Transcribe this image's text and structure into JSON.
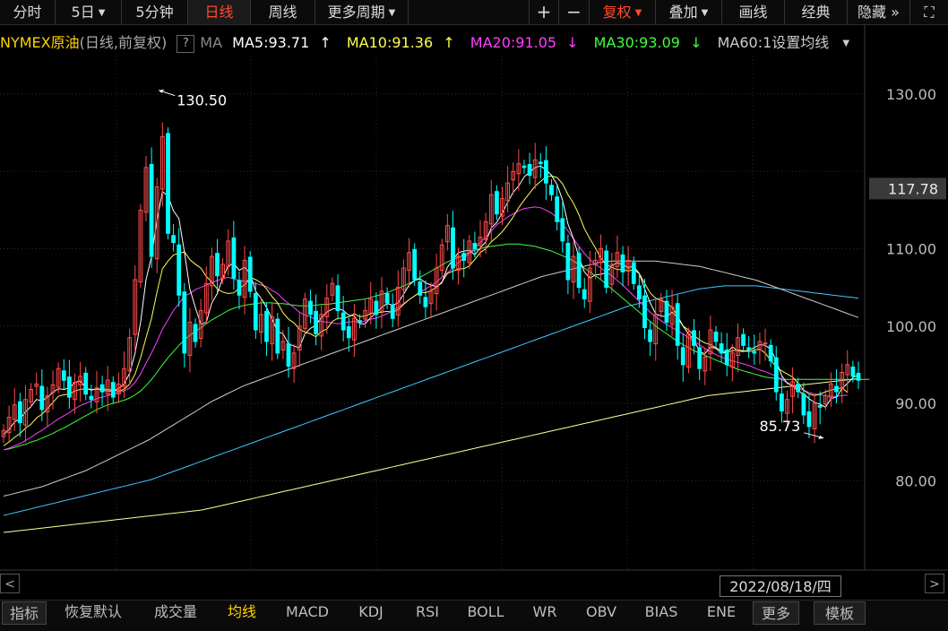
{
  "toolbar": {
    "tabs": [
      {
        "label": "分时"
      },
      {
        "label": "5日"
      },
      {
        "label": "5分钟"
      },
      {
        "label": "日线"
      },
      {
        "label": "周线"
      },
      {
        "label": "更多周期"
      }
    ],
    "plus": "+",
    "minus": "−",
    "fuquan": "复权",
    "diejia": "叠加",
    "huaxian": "画线",
    "jingdian": "经典",
    "yincang": "隐藏",
    "expand_icon": "»",
    "fullscreen_icon": "⛶"
  },
  "legend": {
    "title": "NYMEX原油",
    "subtitle": "(日线,前复权)",
    "help": "?",
    "ma_label": "MA",
    "ma5": "MA5:93.71",
    "ma10": "MA10:91.36",
    "ma20": "MA20:91.05",
    "ma30": "MA30:93.09",
    "ma60": "MA60:1设置均线",
    "up_arrow": "↑",
    "down_arrow": "↓",
    "colors": {
      "ma5": "#ffffff",
      "ma10": "#ffff4d",
      "ma20": "#ff40ff",
      "ma30": "#40ff40",
      "ma60": "#cccccc",
      "ma120": "#3fc8ff",
      "ma250": "#ffff99"
    }
  },
  "yaxis": {
    "ticks": [
      "130.00",
      "110.00",
      "100.00",
      "90.00",
      "80.00"
    ],
    "current_price": "117.78"
  },
  "annotations": {
    "high": "130.50",
    "low": "85.73"
  },
  "date_label": "2022/08/18/四",
  "bottom_tabs": [
    "指标",
    "恢复默认",
    "成交量",
    "均线",
    "MACD",
    "KDJ",
    "RSI",
    "BOLL",
    "WR",
    "OBV",
    "BIAS",
    "ENE",
    "更多",
    "模板"
  ],
  "scroll_left": "<",
  "scroll_right": ">",
  "chart_data": {
    "type": "candlestick",
    "y_range": [
      73,
      134
    ],
    "up_color": "#ff4b4b",
    "down_color": "#00ffff",
    "closes": [
      86.5,
      88.2,
      89.8,
      87.5,
      90.5,
      91.8,
      92.5,
      89.2,
      91.0,
      92.4,
      94.5,
      93.0,
      90.8,
      92.7,
      93.5,
      91.2,
      90.5,
      92.0,
      91.5,
      93.0,
      90.8,
      92.5,
      94.5,
      98.5,
      106.0,
      115.0,
      120.5,
      109.0,
      118.0,
      124.5,
      112.0,
      110.8,
      104.0,
      96.5,
      100.5,
      98.0,
      102.0,
      105.5,
      109.0,
      106.5,
      108.0,
      111.0,
      106.2,
      104.0,
      108.5,
      104.5,
      99.5,
      101.5,
      98.0,
      101.2,
      96.5,
      98.0,
      94.8,
      96.5,
      100.0,
      103.5,
      101.5,
      99.0,
      101.5,
      103.6,
      105.5,
      102.0,
      99.5,
      98.5,
      101.0,
      100.5,
      102.0,
      103.5,
      101.5,
      104.5,
      103.0,
      101.0,
      105.0,
      107.5,
      109.5,
      106.0,
      104.0,
      102.5,
      104.5,
      107.5,
      110.5,
      113.0,
      107.5,
      109.0,
      108.5,
      111.0,
      110.0,
      111.5,
      113.5,
      117.0,
      114.5,
      116.5,
      118.5,
      120.0,
      121.0,
      120.5,
      119.5,
      121.5,
      121.0,
      118.5,
      117.0,
      113.5,
      111.0,
      106.0,
      109.0,
      105.0,
      103.5,
      107.5,
      108.5,
      110.0,
      105.0,
      108.0,
      109.5,
      107.0,
      108.5,
      105.5,
      103.5,
      99.8,
      98.0,
      101.5,
      103.5,
      100.5,
      102.5,
      97.5,
      95.0,
      99.0,
      97.5,
      94.5,
      96.0,
      99.5,
      98.0,
      96.5,
      95.0,
      96.5,
      98.5,
      97.5,
      97.0,
      96.5,
      98.0,
      97.8,
      95.5,
      91.5,
      89.0,
      90.5,
      92.8,
      91.5,
      88.5,
      87.0,
      90.0,
      89.5,
      91.0,
      92.5,
      91.5,
      94.0,
      95.0,
      93.5,
      93.0
    ],
    "ma5": [
      86.0,
      86.6,
      87.6,
      88.0,
      88.9,
      89.6,
      90.5,
      90.3,
      90.8,
      91.4,
      91.9,
      91.8,
      92.0,
      92.7,
      92.9,
      92.0,
      91.7,
      91.9,
      91.7,
      91.6,
      91.6,
      91.9,
      92.5,
      93.9,
      96.5,
      100.5,
      106.0,
      109.0,
      113.7,
      117.4,
      116.8,
      114.9,
      113.9,
      109.6,
      104.8,
      102.4,
      100.2,
      100.5,
      103.0,
      104.2,
      106.2,
      107.8,
      108.1,
      107.2,
      107.6,
      106.8,
      104.5,
      103.6,
      102.4,
      100.9,
      99.3,
      99.0,
      97.7,
      97.4,
      97.2,
      99.0,
      99.7,
      100.1,
      101.1,
      101.8,
      102.2,
      102.3,
      102.0,
      101.4,
      101.3,
      100.3,
      100.3,
      101.1,
      101.7,
      102.4,
      102.9,
      102.7,
      103.0,
      104.1,
      105.3,
      105.9,
      106.1,
      105.6,
      105.3,
      105.1,
      105.6,
      107.6,
      108.6,
      109.5,
      109.7,
      109.8,
      109.2,
      110.1,
      110.9,
      112.7,
      113.4,
      114.6,
      116.0,
      117.3,
      118.1,
      119.3,
      119.9,
      120.5,
      120.7,
      120.2,
      119.5,
      118.3,
      116.3,
      113.2,
      111.3,
      108.9,
      107.0,
      106.2,
      106.6,
      106.7,
      106.9,
      107.8,
      108.2,
      107.9,
      107.6,
      107.7,
      106.8,
      104.8,
      103.0,
      101.6,
      101.3,
      101.2,
      101.8,
      101.1,
      100.0,
      99.0,
      98.2,
      96.7,
      96.4,
      97.3,
      97.1,
      96.5,
      96.6,
      97.3,
      96.8,
      96.7,
      96.9,
      97.2,
      97.6,
      97.5,
      97.0,
      95.5,
      93.6,
      92.6,
      92.3,
      91.6,
      91.2,
      90.6,
      90.1,
      89.9,
      89.5,
      90.6,
      90.8,
      91.9,
      92.6,
      93.3,
      93.7
    ],
    "ma10": [
      84.5,
      85.0,
      85.6,
      86.1,
      86.8,
      87.3,
      88.1,
      88.6,
      89.3,
      90.1,
      90.9,
      91.1,
      91.2,
      91.6,
      91.8,
      91.9,
      91.8,
      91.8,
      91.9,
      91.8,
      91.7,
      91.6,
      91.8,
      92.5,
      93.8,
      95.9,
      98.5,
      101.0,
      104.4,
      107.4,
      108.4,
      109.2,
      109.4,
      109.6,
      108.6,
      108.0,
      107.5,
      106.4,
      105.7,
      104.8,
      104.4,
      104.2,
      104.3,
      104.9,
      105.3,
      106.3,
      106.0,
      105.6,
      104.8,
      103.8,
      103.0,
      101.7,
      100.9,
      100.4,
      99.6,
      99.2,
      99.0,
      98.6,
      99.3,
      99.6,
      100.6,
      101.0,
      101.0,
      101.2,
      101.6,
      101.2,
      101.3,
      101.6,
      101.7,
      101.8,
      101.9,
      101.8,
      102.1,
      102.8,
      103.4,
      103.9,
      104.4,
      104.3,
      104.6,
      105.0,
      105.7,
      106.8,
      107.1,
      107.4,
      107.4,
      107.8,
      108.6,
      109.5,
      110.0,
      110.9,
      111.5,
      112.2,
      113.1,
      114.1,
      115.3,
      116.3,
      117.2,
      118.1,
      118.7,
      119.3,
      119.4,
      119.2,
      118.4,
      117.0,
      115.9,
      114.4,
      112.6,
      111.3,
      110.1,
      108.8,
      107.9,
      107.6,
      107.3,
      107.3,
      107.1,
      107.3,
      106.8,
      105.5,
      104.3,
      103.6,
      103.3,
      103.0,
      102.4,
      101.3,
      100.0,
      99.5,
      98.8,
      98.2,
      97.8,
      97.6,
      97.2,
      96.8,
      96.6,
      96.8,
      96.9,
      96.8,
      96.7,
      96.9,
      97.0,
      96.5,
      95.6,
      94.7,
      94.2,
      93.8,
      93.4,
      92.6,
      91.7,
      91.2,
      91.0,
      91.2,
      91.5,
      91.7,
      91.9,
      92.0,
      91.4
    ],
    "ma20": [
      84.0,
      84.2,
      84.5,
      84.8,
      85.2,
      85.6,
      86.1,
      86.5,
      87.0,
      87.5,
      88.0,
      88.4,
      88.8,
      89.3,
      89.7,
      90.0,
      90.3,
      90.6,
      90.8,
      91.0,
      91.2,
      91.4,
      91.6,
      92.0,
      92.7,
      93.8,
      95.2,
      96.5,
      98.0,
      99.6,
      100.8,
      102.0,
      102.9,
      103.9,
      104.2,
      104.7,
      105.0,
      105.3,
      105.6,
      105.9,
      106.1,
      106.3,
      106.1,
      105.9,
      105.8,
      105.7,
      105.5,
      105.3,
      105.1,
      104.6,
      104.2,
      103.5,
      102.9,
      102.4,
      101.8,
      101.4,
      101.2,
      100.8,
      100.6,
      100.5,
      100.4,
      100.3,
      100.4,
      100.5,
      100.6,
      100.4,
      100.7,
      100.9,
      101.0,
      101.3,
      101.6,
      102.0,
      102.4,
      102.9,
      103.4,
      103.9,
      104.4,
      104.8,
      105.2,
      105.7,
      106.3,
      106.9,
      107.5,
      108.2,
      108.8,
      109.4,
      110.1,
      110.8,
      111.5,
      112.3,
      113.1,
      113.6,
      114.1,
      114.5,
      114.9,
      115.2,
      115.3,
      115.4,
      115.3,
      115.0,
      114.6,
      114.0,
      113.2,
      112.3,
      111.3,
      110.3,
      109.4,
      108.6,
      108.0,
      107.5,
      107.0,
      106.5,
      105.9,
      105.3,
      104.6,
      103.9,
      103.2,
      102.5,
      101.8,
      101.2,
      100.7,
      100.2,
      99.8,
      99.4,
      99.0,
      98.5,
      98.0,
      97.6,
      97.1,
      96.7,
      96.3,
      96.0,
      95.7,
      95.5,
      95.3,
      95.1,
      94.9,
      94.6,
      94.3,
      94.1,
      93.8,
      93.5,
      93.1,
      92.7,
      92.3,
      92.0,
      91.7,
      91.4,
      91.2,
      91.1,
      91.0,
      90.9,
      90.9,
      91.0,
      91.05
    ],
    "ma30": [
      84.0,
      84.1,
      84.3,
      84.5,
      84.7,
      85.0,
      85.2,
      85.5,
      85.8,
      86.1,
      86.5,
      86.8,
      87.2,
      87.6,
      88.0,
      88.4,
      88.8,
      89.2,
      89.5,
      89.8,
      90.0,
      90.2,
      90.4,
      90.7,
      91.1,
      91.6,
      92.3,
      93.1,
      94.0,
      95.0,
      95.9,
      96.7,
      97.5,
      98.2,
      98.8,
      99.3,
      99.8,
      100.3,
      100.8,
      101.2,
      101.6,
      102.0,
      102.3,
      102.5,
      102.7,
      102.8,
      102.9,
      103.0,
      103.0,
      103.0,
      102.9,
      102.9,
      102.8,
      102.7,
      102.6,
      102.6,
      102.6,
      102.7,
      102.8,
      102.8,
      102.9,
      103.0,
      103.1,
      103.2,
      103.3,
      103.4,
      103.5,
      103.7,
      103.9,
      104.1,
      104.3,
      104.6,
      104.9,
      105.2,
      105.5,
      105.9,
      106.3,
      106.7,
      107.1,
      107.5,
      107.9,
      108.3,
      108.6,
      108.9,
      109.2,
      109.5,
      109.8,
      110.0,
      110.2,
      110.3,
      110.4,
      110.5,
      110.6,
      110.6,
      110.6,
      110.5,
      110.4,
      110.3,
      110.1,
      109.9,
      109.7,
      109.4,
      109.1,
      108.8,
      108.4,
      108.0,
      107.5,
      107.0,
      106.5,
      106.0,
      105.4,
      104.8,
      104.2,
      103.6,
      103.0,
      102.4,
      101.8,
      101.2,
      100.6,
      100.0,
      99.5,
      99.0,
      98.5,
      98.0,
      97.6,
      97.2,
      96.8,
      96.5,
      96.2,
      95.9,
      95.6,
      95.3,
      95.0,
      94.7,
      94.4,
      94.2,
      94.0,
      93.8,
      93.6,
      93.4,
      93.3,
      93.2,
      93.1,
      93.1,
      93.09,
      93.09,
      93.09,
      93.09,
      93.09,
      93.09,
      93.09,
      93.09,
      93.09,
      93.09,
      93.09,
      93.09,
      93.09,
      93.09,
      93.09
    ],
    "ma60": [
      78.0,
      78.2,
      78.4,
      78.6,
      78.8,
      79.0,
      79.2,
      79.5,
      79.8,
      80.1,
      80.4,
      80.7,
      81.0,
      81.3,
      81.7,
      82.1,
      82.5,
      82.9,
      83.3,
      83.7,
      84.1,
      84.5,
      84.9,
      85.3,
      85.8,
      86.3,
      86.8,
      87.3,
      87.8,
      88.3,
      88.8,
      89.3,
      89.8,
      90.3,
      90.7,
      91.1,
      91.5,
      91.9,
      92.3,
      92.6,
      92.9,
      93.2,
      93.5,
      93.8,
      94.1,
      94.4,
      94.7,
      95.0,
      95.3,
      95.6,
      95.9,
      96.2,
      96.5,
      96.8,
      97.1,
      97.4,
      97.7,
      98.0,
      98.3,
      98.6,
      98.9,
      99.2,
      99.5,
      99.8,
      100.1,
      100.4,
      100.7,
      101.0,
      101.3,
      101.6,
      101.9,
      102.2,
      102.5,
      102.8,
      103.1,
      103.4,
      103.7,
      104.0,
      104.3,
      104.6,
      104.9,
      105.2,
      105.5,
      105.8,
      106.1,
      106.4,
      106.6,
      106.8,
      107.0,
      107.2,
      107.4,
      107.6,
      107.8,
      108.0,
      108.2,
      108.3,
      108.4,
      108.4,
      108.4,
      108.4,
      108.4,
      108.4,
      108.4,
      108.4,
      108.3,
      108.2,
      108.1,
      108.0,
      107.9,
      107.8,
      107.7,
      107.5,
      107.3,
      107.1,
      106.9,
      106.7,
      106.5,
      106.3,
      106.1,
      105.9,
      105.6,
      105.3,
      105.0,
      104.7,
      104.4,
      104.1,
      103.8,
      103.5,
      103.2,
      102.9,
      102.6,
      102.3,
      102.0,
      101.7,
      101.4,
      101.1
    ],
    "ma120": [
      75.5,
      75.7,
      75.9,
      76.1,
      76.3,
      76.5,
      76.7,
      76.9,
      77.1,
      77.3,
      77.5,
      77.7,
      77.9,
      78.1,
      78.3,
      78.5,
      78.7,
      78.9,
      79.1,
      79.3,
      79.5,
      79.7,
      79.9,
      80.1,
      80.4,
      80.7,
      81.0,
      81.3,
      81.6,
      81.9,
      82.2,
      82.5,
      82.8,
      83.1,
      83.4,
      83.7,
      84.0,
      84.3,
      84.6,
      84.9,
      85.2,
      85.5,
      85.8,
      86.1,
      86.4,
      86.7,
      87.0,
      87.3,
      87.6,
      87.9,
      88.2,
      88.5,
      88.8,
      89.1,
      89.4,
      89.7,
      90.0,
      90.3,
      90.6,
      90.9,
      91.2,
      91.5,
      91.8,
      92.1,
      92.4,
      92.7,
      93.0,
      93.3,
      93.6,
      93.9,
      94.2,
      94.5,
      94.8,
      95.1,
      95.4,
      95.7,
      96.0,
      96.3,
      96.6,
      96.9,
      97.2,
      97.5,
      97.8,
      98.1,
      98.4,
      98.7,
      99.0,
      99.3,
      99.6,
      99.9,
      100.2,
      100.5,
      100.8,
      101.1,
      101.4,
      101.7,
      102.0,
      102.3,
      102.6,
      102.8,
      103.0,
      103.2,
      103.4,
      103.6,
      103.8,
      104.0,
      104.2,
      104.4,
      104.6,
      104.8,
      104.9,
      105.0,
      105.1,
      105.2,
      105.2,
      105.2,
      105.2,
      105.2,
      105.2,
      105.1,
      105.0,
      104.9,
      104.8,
      104.7,
      104.6,
      104.5,
      104.4,
      104.3,
      104.2,
      104.1,
      104.0,
      103.9,
      103.8,
      103.7,
      103.6
    ],
    "ma250": [
      73.3,
      73.4,
      73.5,
      73.6,
      73.7,
      73.8,
      73.9,
      74.0,
      74.1,
      74.2,
      74.3,
      74.4,
      74.5,
      74.6,
      74.7,
      74.8,
      74.9,
      75.0,
      75.1,
      75.2,
      75.3,
      75.4,
      75.5,
      75.6,
      75.7,
      75.8,
      75.9,
      76.0,
      76.1,
      76.2,
      76.4,
      76.6,
      76.8,
      77.0,
      77.2,
      77.4,
      77.6,
      77.8,
      78.0,
      78.2,
      78.4,
      78.6,
      78.8,
      79.0,
      79.2,
      79.4,
      79.6,
      79.8,
      80.0,
      80.2,
      80.4,
      80.6,
      80.8,
      81.0,
      81.2,
      81.4,
      81.6,
      81.8,
      82.0,
      82.2,
      82.4,
      82.6,
      82.8,
      83.0,
      83.2,
      83.4,
      83.6,
      83.8,
      84.0,
      84.2,
      84.4,
      84.6,
      84.8,
      85.0,
      85.2,
      85.4,
      85.6,
      85.8,
      86.0,
      86.2,
      86.4,
      86.6,
      86.8,
      87.0,
      87.2,
      87.4,
      87.6,
      87.8,
      88.0,
      88.2,
      88.4,
      88.6,
      88.8,
      89.0,
      89.2,
      89.4,
      89.6,
      89.8,
      90.0,
      90.2,
      90.4,
      90.6,
      90.8,
      91.0,
      91.1,
      91.2,
      91.3,
      91.4,
      91.5,
      91.6,
      91.7,
      91.8,
      91.9,
      92.0,
      92.1,
      92.2,
      92.3,
      92.4,
      92.5,
      92.6,
      92.7,
      92.8,
      92.9,
      93.0,
      93.1,
      93.2
    ]
  }
}
